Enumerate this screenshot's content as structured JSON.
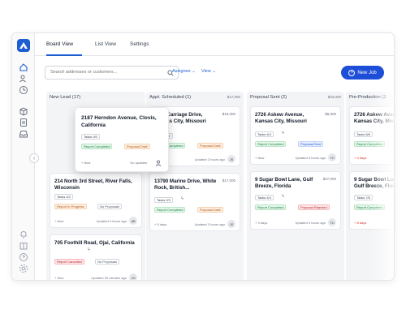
{
  "tabs": [
    "Board View",
    "List View",
    "Settings"
  ],
  "search": {
    "placeholder": "Search addresses or customers..."
  },
  "filters": {
    "assignee": "Assignee",
    "view": "View"
  },
  "new_job_label": "New Job",
  "sidebar": {
    "top_icons": [
      "home-icon",
      "users-icon",
      "clock-icon",
      "box-icon",
      "document-icon",
      "inbox-icon"
    ],
    "bottom_icons": [
      "bell-icon",
      "book-icon",
      "help-icon",
      "settings-icon"
    ]
  },
  "columns": {
    "new_lead": {
      "title": "New Lead (17)",
      "amount": ""
    },
    "appt": {
      "title": "Appt. Scheduled (1)",
      "amount": "$17,000"
    },
    "proposal": {
      "title": "Proposal Sent (2)",
      "amount": "$33,000"
    },
    "preprod": {
      "title": "Pre-Production (2",
      "amount": ""
    }
  },
  "popover": {
    "address": "2187 Herndon Avenue, Clovis, California",
    "tasks": "Tasks 0/0",
    "badges": [
      "Report Completed",
      "Proposal Draft"
    ],
    "new": "+ New",
    "updates": "No updates"
  },
  "cards": {
    "c1": {
      "address": "214 North 3rd Street, River Falls, Wisconsin",
      "tasks": "Tasks 0/2",
      "badges": [
        "Report In Progress",
        "No Proposals"
      ],
      "new": "+ New",
      "updated": "Updated 4 hours ago",
      "avatar": "AB"
    },
    "c2": {
      "address": "705 Foothill Road, Ojai, California",
      "badges": [
        "Report Cancelled",
        "No Proposals"
      ],
      "new": "+ New",
      "updated": "Updated 30 minutes ago",
      "avatar": "JO"
    },
    "c3": {
      "address": "2180 Carriage Drive, Kansas City, Missouri",
      "price": "$19,000",
      "tasks": "Tasks 0/2",
      "badges": [
        "Report Completed",
        "Proposal Draft"
      ],
      "updated": "Updated 3 hours ago",
      "avatar": "JS"
    },
    "c4": {
      "address": "13790 Marine Drive, White Rock, British...",
      "price": "$17,000",
      "tasks": "Tasks 2/3",
      "badges": [
        "Report Completed",
        "Proposal Draft"
      ],
      "days": "+ 5 days",
      "updated": "Updated 3 hours ago",
      "avatar": "JS"
    },
    "c5": {
      "address": "2726 Askew Avenue, Kansas City, Missouri",
      "price": "$6,000",
      "tasks": "Tasks 4/4",
      "badges": [
        "Report Completed",
        "Proposal Sent"
      ],
      "new": "+ New",
      "updated": "Updated 5 hours ago",
      "avatar": "TC"
    },
    "c6": {
      "address": "9 Sugar Bowl Lane, Gulf Breeze, Florida",
      "price": "$27,000",
      "tasks": "Tasks 4/4",
      "badges": [
        "Report Completed",
        "Proposal Rejected"
      ],
      "days": "+ 3 days",
      "updated": "Updated 3 hours ago",
      "avatar": "TC"
    },
    "c7": {
      "address": "2726 Askew Avenue, Kansas City, Missouri",
      "tasks": "Tasks 6/6",
      "badges": [
        "Report Completed"
      ],
      "late": "+ 4 days"
    },
    "c8": {
      "address": "9 Sugar Bowl Lane, Gulf Breeze, Florida",
      "tasks": "Tasks 7/6",
      "badges": [
        "Report Completed"
      ],
      "late": "+ 8 days"
    }
  },
  "colors": {
    "primary": "#1d4ed8",
    "green": "#15803d",
    "orange": "#b45309",
    "red": "#b91c1c"
  }
}
